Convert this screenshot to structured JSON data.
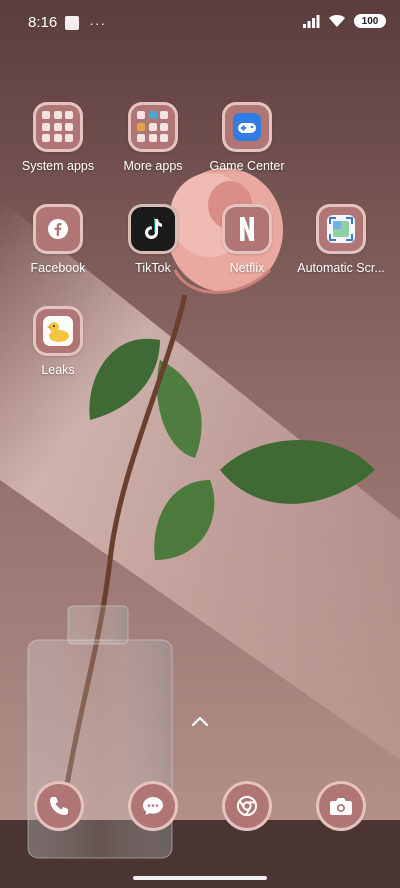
{
  "status_bar": {
    "time": "8:16",
    "more": "···",
    "battery": "100"
  },
  "apps": [
    {
      "label": "System apps",
      "icon": "folder-icon"
    },
    {
      "label": "More apps",
      "icon": "folder-icon"
    },
    {
      "label": "Game Center",
      "icon": "gamepad-icon"
    },
    {
      "label": "Facebook",
      "icon": "facebook-icon"
    },
    {
      "label": "TikTok",
      "icon": "tiktok-icon"
    },
    {
      "label": "Netflix",
      "icon": "netflix-icon"
    },
    {
      "label": "Automatic Scr...",
      "icon": "screenshot-icon"
    },
    {
      "label": "Leaks",
      "icon": "duck-icon"
    }
  ],
  "dock": [
    {
      "icon": "phone-icon"
    },
    {
      "icon": "messages-icon"
    },
    {
      "icon": "chrome-icon"
    },
    {
      "icon": "camera-icon"
    }
  ],
  "colors": {
    "icon_bg": "#b07676",
    "wall_top": "#6a4848",
    "wall_bottom": "#c8a4a0"
  }
}
